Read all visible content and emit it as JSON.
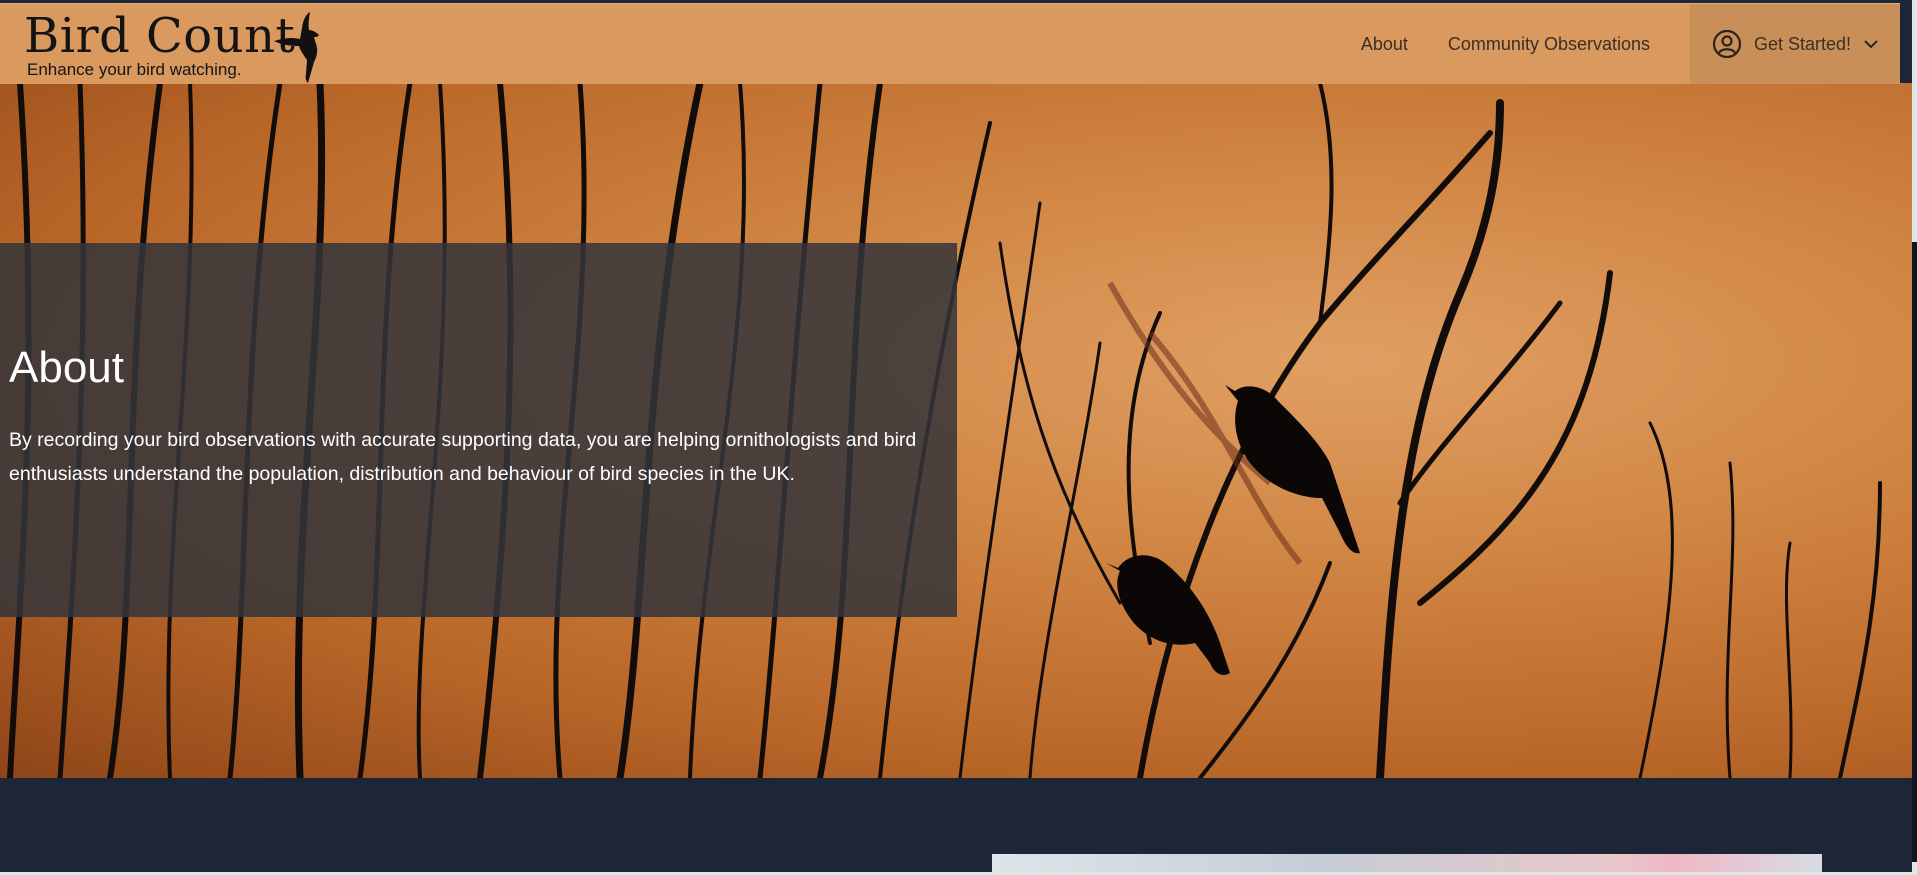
{
  "brand": {
    "title": "Bird Count",
    "tagline": "Enhance your bird watching."
  },
  "nav": {
    "links": [
      "About",
      "Community Observations"
    ],
    "get_started_label": "Get Started!"
  },
  "hero": {
    "heading": "About",
    "body": "By recording your bird observations with accurate supporting data, you are helping ornithologists and bird enthusiasts understand the population, distribution and behaviour of bird species in the UK."
  },
  "colors": {
    "navbar": "#d9995f",
    "overlay": "#34343a",
    "section_dark": "#1d2636"
  },
  "icons": [
    "bird-logo-icon",
    "user-circle-icon",
    "chevron-down-icon"
  ]
}
